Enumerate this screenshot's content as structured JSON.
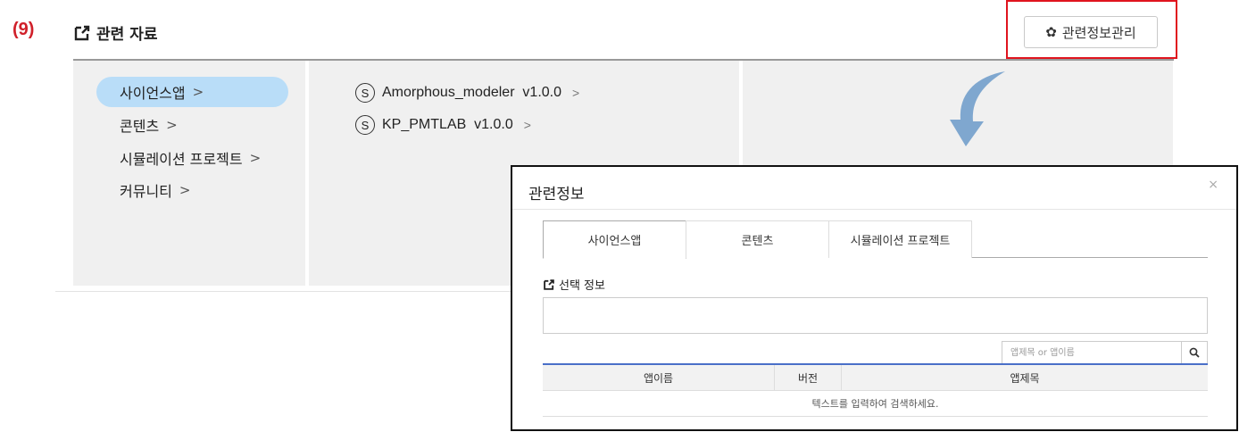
{
  "step_label": "(9)",
  "section": {
    "title": "관련 자료",
    "icon": "external-link-icon"
  },
  "manage_button": {
    "label": "관련정보관리",
    "icon": "gear-icon"
  },
  "categories": [
    {
      "label": "사이언스앱",
      "chevron": ">",
      "active": true
    },
    {
      "label": "콘텐츠",
      "chevron": ">"
    },
    {
      "label": "시뮬레이션 프로젝트",
      "chevron": ">"
    },
    {
      "label": "커뮤니티",
      "chevron": ">"
    }
  ],
  "apps": [
    {
      "icon_letter": "S",
      "label": "Amorphous_modeler  v1.0.0",
      "chevron": ">"
    },
    {
      "icon_letter": "S",
      "label": "KP_PMTLAB  v1.0.0",
      "chevron": ">"
    }
  ],
  "modal": {
    "title": "관련정보",
    "close": "×",
    "tabs": [
      "사이언스앱",
      "콘텐츠",
      "시뮬레이션 프로젝트"
    ],
    "selection_title": "선택 정보",
    "search_placeholder": "앱제목 or 앱이름",
    "table": {
      "columns": [
        "앱이름",
        "버전",
        "앱제목"
      ],
      "empty_message": "텍스트를 입력하여 검색하세요."
    }
  },
  "colors": {
    "step": "#d0202a",
    "highlight": "#e0141e",
    "active_category": "#b9ddf8",
    "arrow": "#7fa7cf",
    "table_accent": "#4a6fc8"
  }
}
